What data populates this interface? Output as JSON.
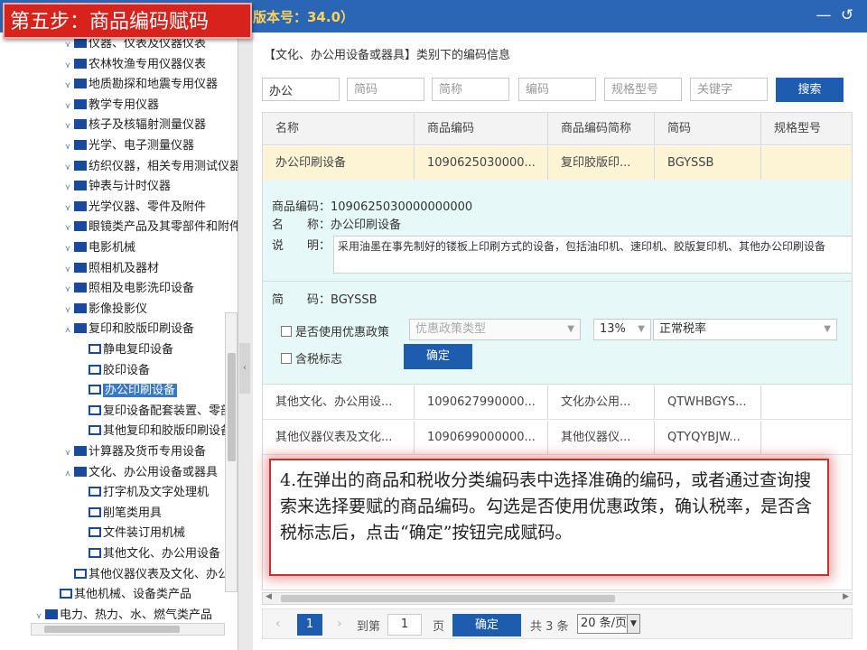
{
  "step_label": "第五步：商品编码赋码",
  "header": {
    "version": "版本号：34.0）",
    "minimize_icon": "minimize-icon",
    "back_icon": "back-icon"
  },
  "tree": {
    "items": [
      {
        "label": "仪器、仪表及仪器仪表",
        "indent": 3,
        "icon": "folder",
        "expander": "collapsed"
      },
      {
        "label": "农林牧渔专用仪器仪表",
        "indent": 3,
        "icon": "folder",
        "expander": "collapsed"
      },
      {
        "label": "地质勘探和地震专用仪器",
        "indent": 3,
        "icon": "folder",
        "expander": "collapsed"
      },
      {
        "label": "教学专用仪器",
        "indent": 3,
        "icon": "folder",
        "expander": "collapsed"
      },
      {
        "label": "核子及核辐射测量仪器",
        "indent": 3,
        "icon": "folder",
        "expander": "collapsed"
      },
      {
        "label": "光学、电子测量仪器",
        "indent": 3,
        "icon": "folder",
        "expander": "collapsed"
      },
      {
        "label": "纺织仪器，相关专用测试仪器",
        "indent": 3,
        "icon": "folder",
        "expander": "collapsed"
      },
      {
        "label": "钟表与计时仪器",
        "indent": 3,
        "icon": "folder",
        "expander": "collapsed"
      },
      {
        "label": "光学仪器、零件及附件",
        "indent": 3,
        "icon": "folder",
        "expander": "collapsed"
      },
      {
        "label": "眼镜类产品及其零部件和附件",
        "indent": 3,
        "icon": "folder",
        "expander": "collapsed"
      },
      {
        "label": "电影机械",
        "indent": 3,
        "icon": "folder",
        "expander": "collapsed"
      },
      {
        "label": "照相机及器材",
        "indent": 3,
        "icon": "folder",
        "expander": "collapsed"
      },
      {
        "label": "照相及电影洗印设备",
        "indent": 3,
        "icon": "folder",
        "expander": "collapsed"
      },
      {
        "label": "影像投影仪",
        "indent": 3,
        "icon": "folder",
        "expander": "collapsed"
      },
      {
        "label": "复印和胶版印刷设备",
        "indent": 3,
        "icon": "folder",
        "expander": "expanded"
      },
      {
        "label": "静电复印设备",
        "indent": 4,
        "icon": "page",
        "expander": "none"
      },
      {
        "label": "胶印设备",
        "indent": 4,
        "icon": "page",
        "expander": "none"
      },
      {
        "label": "办公印刷设备",
        "indent": 4,
        "icon": "page",
        "expander": "none",
        "selected": true
      },
      {
        "label": "复印设备配套装置、零部件",
        "indent": 4,
        "icon": "page",
        "expander": "none"
      },
      {
        "label": "其他复印和胶版印刷设备",
        "indent": 4,
        "icon": "page",
        "expander": "none"
      },
      {
        "label": "计算器及货币专用设备",
        "indent": 3,
        "icon": "folder",
        "expander": "collapsed"
      },
      {
        "label": "文化、办公用设备或器具",
        "indent": 3,
        "icon": "folder",
        "expander": "expanded"
      },
      {
        "label": "打字机及文字处理机",
        "indent": 4,
        "icon": "page",
        "expander": "none"
      },
      {
        "label": "削笔类用具",
        "indent": 4,
        "icon": "page",
        "expander": "none"
      },
      {
        "label": "文件装订用机械",
        "indent": 4,
        "icon": "page",
        "expander": "none"
      },
      {
        "label": "其他文化、办公用设备",
        "indent": 4,
        "icon": "page",
        "expander": "none"
      },
      {
        "label": "其他仪器仪表及文化、办公用机械",
        "indent": 3,
        "icon": "page",
        "expander": "none"
      },
      {
        "label": "其他机械、设备类产品",
        "indent": 2,
        "icon": "page",
        "expander": "none"
      },
      {
        "label": "电力、热力、水、燃气类产品",
        "indent": 1,
        "icon": "folder",
        "expander": "collapsed"
      }
    ]
  },
  "category_title": "【文化、办公用设备或器具】类别下的编码信息",
  "filters": [
    {
      "value": "办公",
      "placeholder": ""
    },
    {
      "value": "",
      "placeholder": "简码"
    },
    {
      "value": "",
      "placeholder": "简称"
    },
    {
      "value": "",
      "placeholder": "编码"
    },
    {
      "value": "",
      "placeholder": "规格型号"
    },
    {
      "value": "",
      "placeholder": "关键字"
    }
  ],
  "search_label": "搜索",
  "table": {
    "columns": [
      "名称",
      "商品编码",
      "商品编码简称",
      "简码",
      "规格型号"
    ],
    "rows": [
      [
        "办公印刷设备",
        "1090625030000...",
        "复印胶版印...",
        "BGYSSB",
        ""
      ],
      [
        "其他文化、办公用设...",
        "1090627990000...",
        "文化办公用...",
        "QTWHBGYS...",
        ""
      ],
      [
        "其他仪器仪表及文化...",
        "1090699000000...",
        "其他仪器仪...",
        "QTYQYBJW...",
        ""
      ]
    ]
  },
  "detail": {
    "code_label": "商品编码：",
    "code_value": "1090625030000000000",
    "name_label": "名　　称：",
    "name_value": "办公印刷设备",
    "desc_label": "说　　明：",
    "desc_value": "采用油墨在事先制好的镂板上印刷方式的设备，包括油印机、速印机、胶版复印机、其他办公印刷设备",
    "jm_label": "简　　码：",
    "jm_value": "BGYSSB",
    "preferential_label": "是否使用优惠政策",
    "preferential_type_placeholder": "优惠政策类型",
    "tax_rate": "13%",
    "tax_type": "正常税率",
    "tax_included_label": "含税标志",
    "confirm_label": "确定"
  },
  "pager": {
    "current_page": "1",
    "goto_label": "到第",
    "goto_value": "1",
    "page_unit": "页",
    "confirm_label": "确定",
    "total": "共 3 条",
    "page_size": "20 条/页"
  },
  "callout": "4.在弹出的商品和税收分类编码表中选择准确的编码，或者通过查询搜索来选择要赋的商品编码。勾选是否使用优惠政策，确认税率，是否含税标志后，点击“确定”按钮完成赋码。"
}
